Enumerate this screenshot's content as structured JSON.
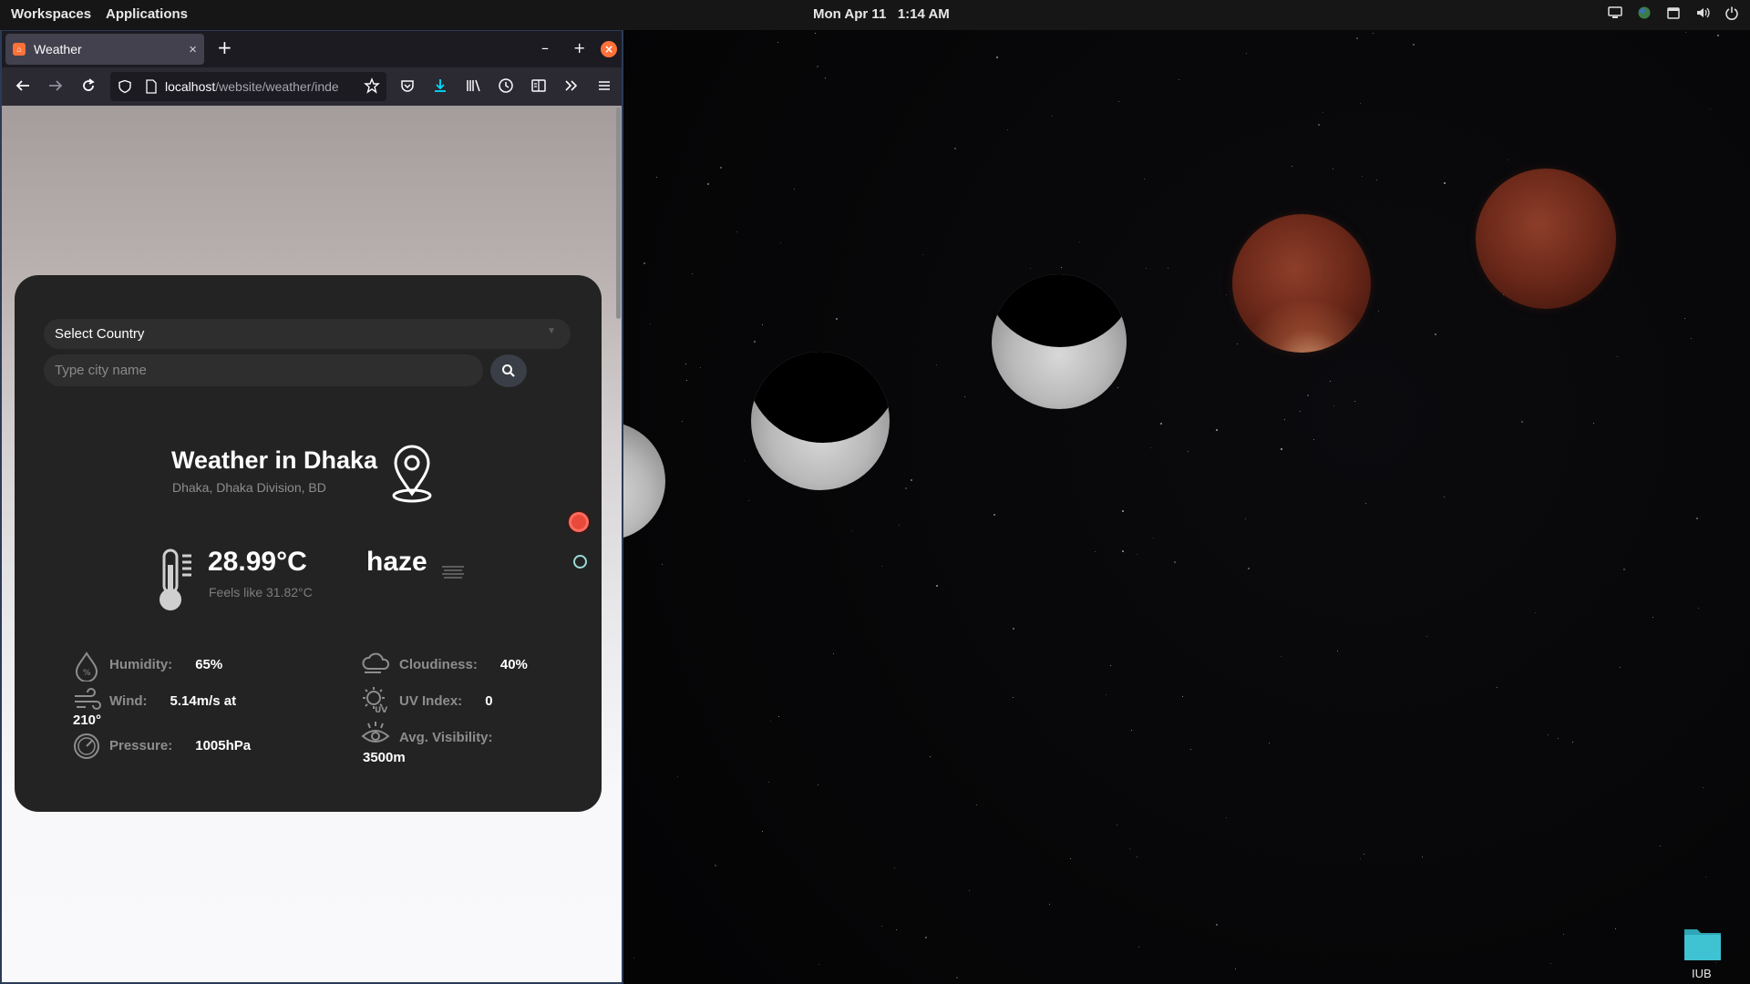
{
  "topbar": {
    "workspaces": "Workspaces",
    "applications": "Applications",
    "date": "Mon Apr 11",
    "time": "1:14 AM"
  },
  "tray_icons": [
    "screen-icon",
    "globe-icon",
    "clipboard-icon",
    "volume-icon",
    "power-icon"
  ],
  "browser": {
    "tab_title": "Weather",
    "url_host": "localhost",
    "url_path": "/website/weather/inde",
    "new_tab": "+",
    "minimize": "–",
    "maximize": "+",
    "close": "×",
    "tab_close": "×"
  },
  "weather": {
    "country_placeholder": "Select Country",
    "city_placeholder": "Type city name",
    "title": "Weather in Dhaka",
    "subtitle": "Dhaka, Dhaka Division, BD",
    "temperature": "28.99°C",
    "feels_like": "Feels like 31.82°C",
    "description": "haze",
    "stats": {
      "humidity_label": "Humidity:",
      "humidity_value": "65%",
      "wind_label": "Wind:",
      "wind_value": "5.14m/s at",
      "wind_dir": "210°",
      "pressure_label": "Pressure:",
      "pressure_value": "1005hPa",
      "cloudiness_label": "Cloudiness:",
      "cloudiness_value": "40%",
      "uv_label": "UV Index:",
      "uv_value": "0",
      "visibility_label": "Avg. Visibility:",
      "visibility_value": "3500m"
    }
  },
  "desktop": {
    "folder_label": "IUB"
  },
  "colors": {
    "card_bg": "#232323",
    "topbar_bg": "#161616",
    "firefox_accent": "#ff7139",
    "folder": "#3ab8c8"
  }
}
